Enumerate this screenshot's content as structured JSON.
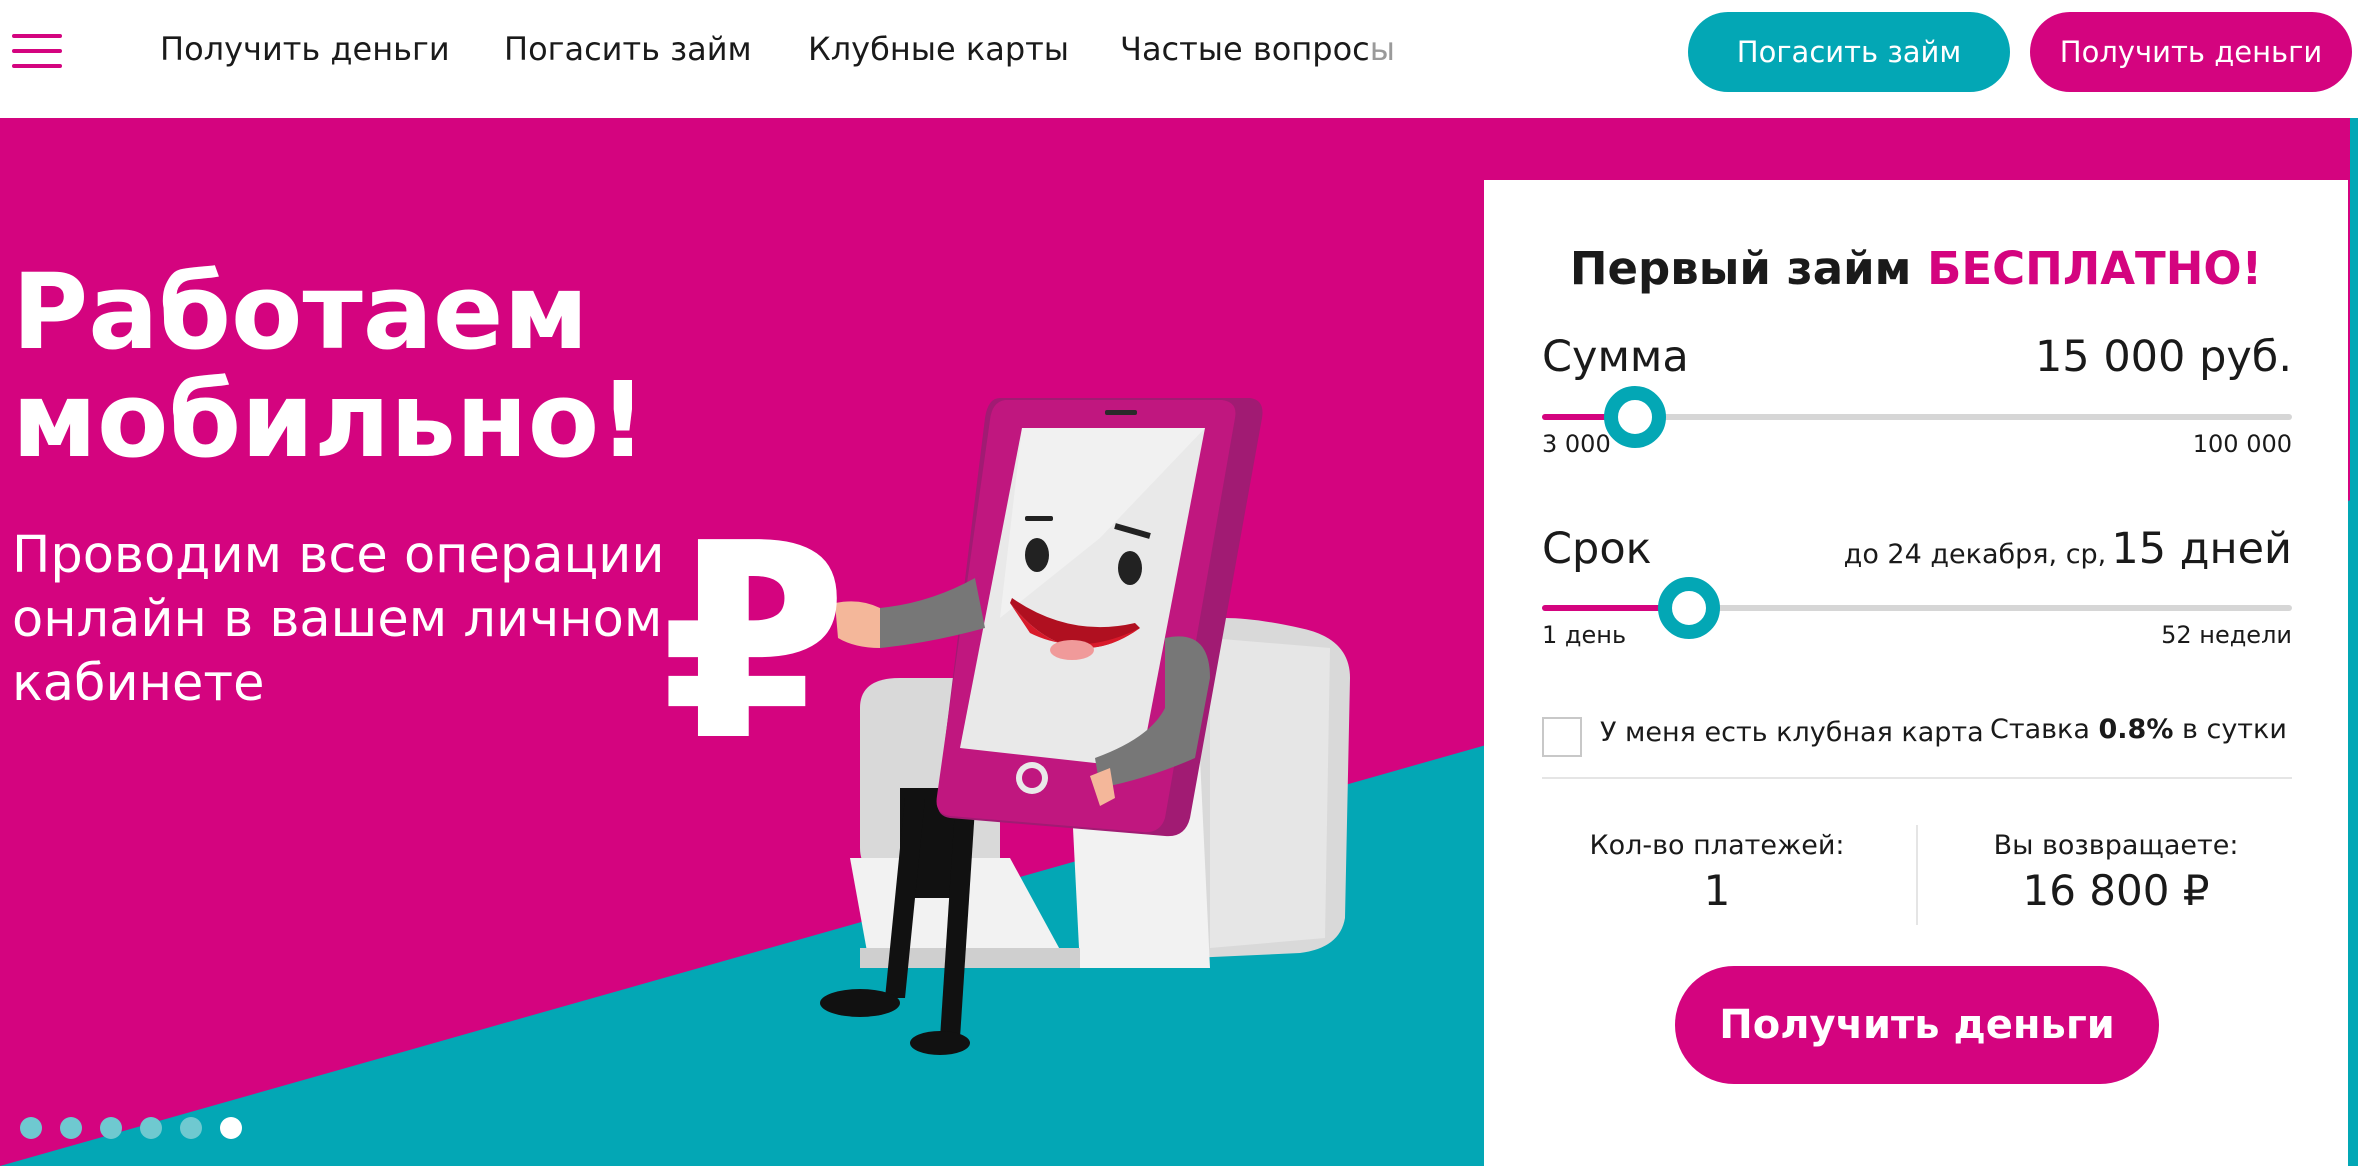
{
  "header": {
    "nav": [
      "Получить деньги",
      "Погасить займ",
      "Клубные карты",
      "Частые вопрос"
    ],
    "nav_last_tail": "ы",
    "btn_repay": "Погасить займ",
    "btn_get": "Получить деньги"
  },
  "hero": {
    "title_line1": "Работаем",
    "title_line2": "мобильно!",
    "subtitle": "Проводим все операции онлайн в вашем личном кабинете",
    "ruble_symbol": "₽",
    "slides_count": 6,
    "active_slide": 6
  },
  "calculator": {
    "title_main": "Первый займ",
    "title_accent": "БЕСПЛАТНО!",
    "amount": {
      "label": "Сумма",
      "value": "15 000  руб.",
      "min_label": "3 000",
      "max_label": "100 000",
      "fraction": 0.124
    },
    "term": {
      "label": "Срок",
      "date_text": "до 24 декабря, ср,",
      "value": "15 дней",
      "min_label": "1 день",
      "max_label": "52 недели",
      "fraction": 0.196
    },
    "club_card_label": "У меня есть клубная карта",
    "club_card_checked": false,
    "rate_prefix": "Ставка",
    "rate_value": "0.8%",
    "rate_suffix": "в сутки",
    "payments_label": "Кол-во платежей:",
    "payments_value": "1",
    "return_label": "Вы возвращаете:",
    "return_value": "16 800 ₽",
    "cta": "Получить деньги"
  },
  "colors": {
    "brand_pink": "#d4047f",
    "brand_teal": "#03a7b5"
  },
  "icons": [
    "menu-icon",
    "ruble-icon"
  ]
}
